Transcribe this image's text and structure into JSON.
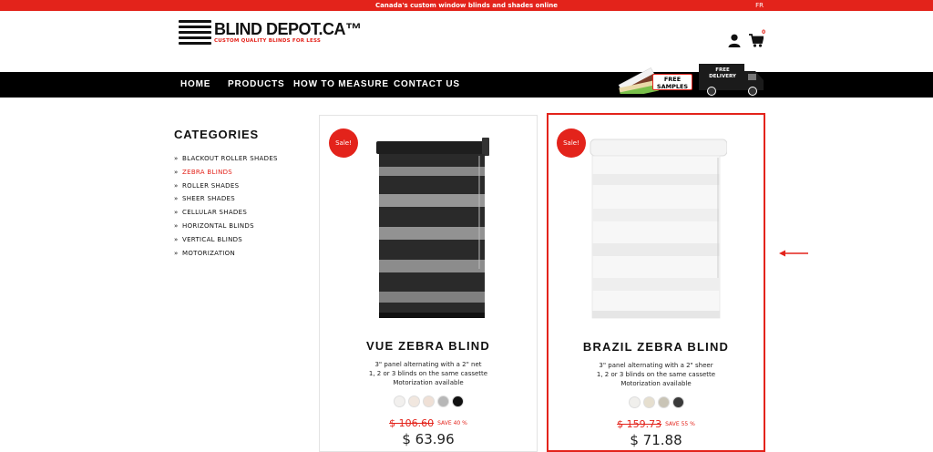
{
  "topbar": {
    "message": "Canada's custom window blinds and shades online",
    "language": "FR"
  },
  "header": {
    "logo_name": "BLIND DEPOT.CA™",
    "logo_tagline": "CUSTOM QUALITY BLINDS FOR LESS",
    "cart_count": "0",
    "icons": [
      "user-icon",
      "cart-icon"
    ]
  },
  "nav": {
    "items": [
      "HOME",
      "PRODUCTS",
      "HOW TO MEASURE",
      "CONTACT US"
    ],
    "free_samples": [
      "FREE",
      "SAMPLES"
    ],
    "free_delivery": [
      "FREE",
      "DELIVERY"
    ]
  },
  "sidebar": {
    "title": "CATEGORIES",
    "arrow": "»",
    "items": [
      "BLACKOUT ROLLER SHADES",
      "ZEBRA BLINDS",
      "ROLLER SHADES",
      "SHEER SHADES",
      "CELLULAR SHADES",
      "HORIZONTAL BLINDS",
      "VERTICAL BLINDS",
      "MOTORIZATION"
    ],
    "active_item": "ZEBRA BLINDS"
  },
  "products": [
    {
      "badge": "Sale!",
      "title": "VUE ZEBRA BLIND",
      "desc": [
        "3\" panel alternating with a 2\" net",
        "1, 2 or 3 blinds on the same cassette",
        "Motorization available"
      ],
      "swatches": [
        "#f2f0ee",
        "#f1e7df",
        "#efe0d6",
        "#b7b7b7",
        "#111111"
      ],
      "old_price": "$ 106.60",
      "save": "SAVE 40 %",
      "price": "$ 63.96"
    },
    {
      "badge": "Sale!",
      "title": "BRAZIL ZEBRA BLIND",
      "desc": [
        "3\" panel alternating with a 2\" sheer",
        "1, 2 or 3 blinds on the same cassette",
        "Motorization available"
      ],
      "swatches": [
        "#f0efec",
        "#e6dfcf",
        "#c9c4b6",
        "#3a3a3a"
      ],
      "old_price": "$ 159.73",
      "save": "SAVE 55 %",
      "price": "$ 71.88"
    }
  ],
  "colors": {
    "accent": "#e3231b",
    "nav_bg": "#000000"
  }
}
